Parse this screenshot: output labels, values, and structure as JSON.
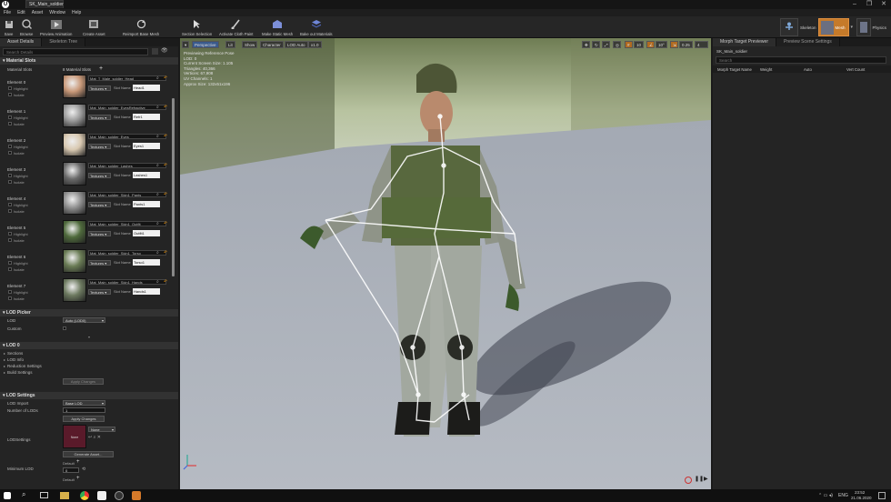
{
  "window": {
    "tab_title": "SK_Main_soldier",
    "min": "–",
    "max": "❐",
    "close": "✕"
  },
  "menu": [
    "File",
    "Edit",
    "Asset",
    "Window",
    "Help"
  ],
  "toolbar": [
    {
      "label": "Save",
      "icon": "save-icon"
    },
    {
      "label": "Browse",
      "icon": "browse-icon"
    },
    {
      "label": "Preview Animation",
      "icon": "preview-animation-icon"
    },
    {
      "label": "Create Asset",
      "icon": "create-asset-icon"
    },
    {
      "label": "Reimport Base Mesh",
      "icon": "reimport-icon"
    },
    {
      "label": "Section Selection",
      "icon": "section-selection-icon"
    },
    {
      "label": "Activate Cloth Paint",
      "icon": "cloth-paint-icon"
    },
    {
      "label": "Make Static Mesh",
      "icon": "static-mesh-icon"
    },
    {
      "label": "Bake out Materials",
      "icon": "bake-materials-icon"
    }
  ],
  "modes": {
    "skeleton": "Skeleton",
    "mesh": "Mesh",
    "physics": "Physics"
  },
  "left_panel": {
    "tabs": [
      "Asset Details",
      "Skeleton Tree"
    ],
    "search_placeholder": "Search Details",
    "material_slots": {
      "header": "Material Slots",
      "slots_label": "Material Slots",
      "slots_count": "8 Material Slots",
      "highlight": "Highlight",
      "isolate": "Isolate",
      "textures": "Textures",
      "slot_name_label": "Slot Name",
      "elements": [
        {
          "label": "Element 0",
          "material": "Mat_T_Male_soldier_Head",
          "slot": "Head1",
          "thumb": "#c89878"
        },
        {
          "label": "Element 1",
          "material": "Mat_Main_soldier_EyesRefractive",
          "slot": "Refr1",
          "thumb": "#9a9a9a"
        },
        {
          "label": "Element 2",
          "material": "Mat_Main_soldier_Eyes",
          "slot": "Eyes1",
          "thumb": "#d8c8b0"
        },
        {
          "label": "Element 3",
          "material": "Mat_Main_soldier_Lashes",
          "slot": "Lashes1",
          "thumb": "#6a6a6a"
        },
        {
          "label": "Element 4",
          "material": "Mat_Main_soldier_Skin1_Pants",
          "slot": "Pants1",
          "thumb": "#8e8e8e"
        },
        {
          "label": "Element 5",
          "material": "Mat_Main_soldier_Skin1_Outfit",
          "slot": "Outfit1",
          "thumb": "#4f6a3c"
        },
        {
          "label": "Element 6",
          "material": "Mat_Main_soldier_Skin1_Torso",
          "slot": "Torso1",
          "thumb": "#6a7c55"
        },
        {
          "label": "Element 7",
          "material": "Mat_Main_soldier_Skin1_Hands",
          "slot": "Hands1",
          "thumb": "#6d7a60"
        }
      ]
    },
    "lod_picker": {
      "header": "LOD Picker",
      "lod_label": "LOD",
      "lod_value": "Auto (LOD0)",
      "custom_label": "Custom"
    },
    "lod0": {
      "header": "LOD 0",
      "items": [
        "Sections",
        "LOD Info",
        "Reduction Settings",
        "Build Settings"
      ],
      "apply": "Apply Changes"
    },
    "lod_settings": {
      "header": "LOD Settings",
      "import_label": "LOD Import",
      "import_value": "Base LOD",
      "num_label": "Number of LODs",
      "num_value": "1",
      "apply": "Apply Changes",
      "lodsettings_label": "LODSettings",
      "lodsettings_none": "None",
      "lodsettings_thumb": "None",
      "generate": "Generate Asset...",
      "min_lod_label": "Minimum LOD",
      "default": "Default",
      "min_lod_value": "0"
    }
  },
  "viewport": {
    "buttons": [
      "Perspective",
      "Lit",
      "Show",
      "Character",
      "LOD Auto",
      "x1.0"
    ],
    "stats": [
      "Previewing Reference Pose",
      "LOD: 0",
      "Current Screen Size: 1.105",
      "Triangles: 40,366",
      "Vertices: 67,908",
      "UV Channels: 1",
      "Approx Size: 132x51x196"
    ],
    "snap": [
      "10",
      "10°",
      "0.25",
      "4"
    ]
  },
  "right_panel": {
    "tabs": [
      "Morph Target Previewer",
      "Preview Scene Settings"
    ],
    "asset": "SK_Main_soldier",
    "search_placeholder": "Search",
    "columns": [
      "Morph Target Name",
      "Weight",
      "Auto",
      "Vert Count"
    ]
  },
  "taskbar": {
    "lang": "ENG",
    "time": "23:52",
    "date": "21.06.2020"
  }
}
